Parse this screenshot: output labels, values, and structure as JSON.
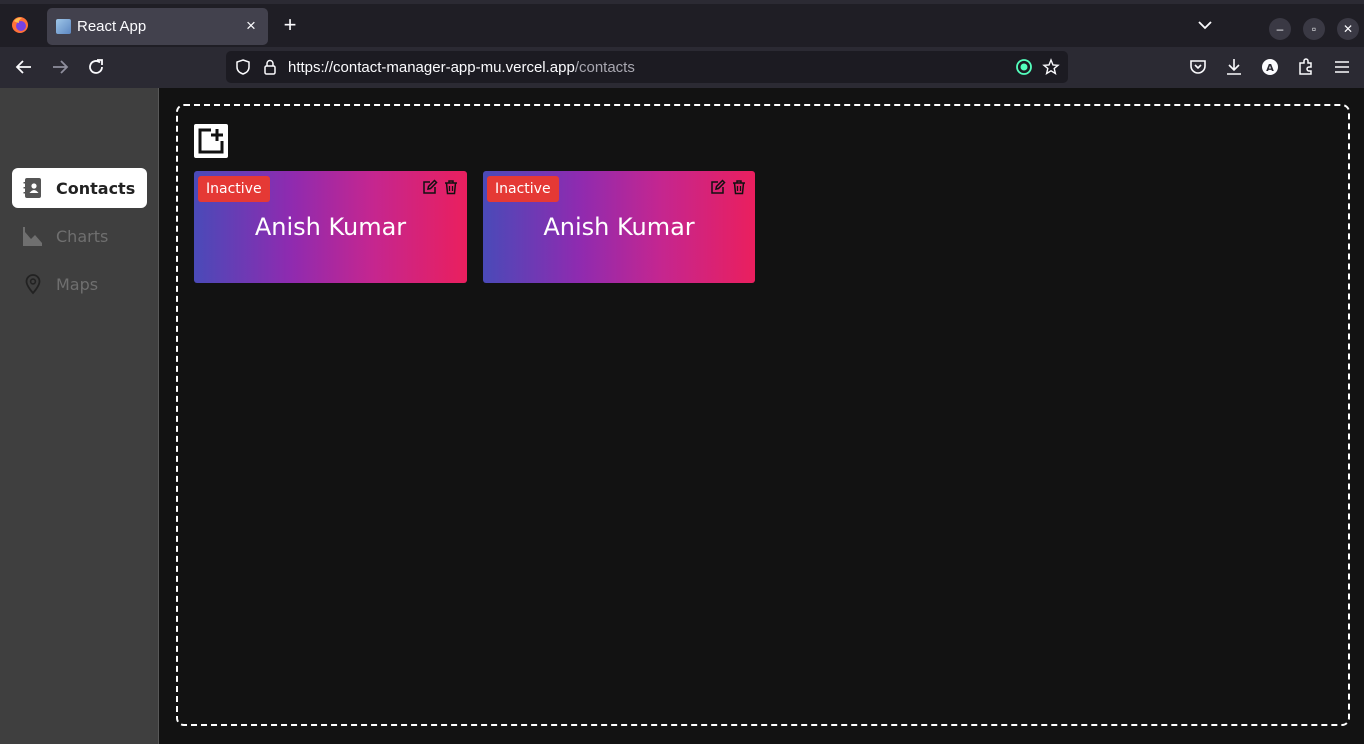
{
  "browser": {
    "tab_title": "React App",
    "url_main": "https://contact-manager-app-mu.vercel.app",
    "url_path": "/contacts"
  },
  "sidebar": {
    "items": [
      {
        "label": "Contacts",
        "icon": "contacts-book-icon",
        "active": true
      },
      {
        "label": "Charts",
        "icon": "chart-icon",
        "active": false
      },
      {
        "label": "Maps",
        "icon": "map-pin-icon",
        "active": false
      }
    ]
  },
  "contacts": {
    "add_icon": "add-contact-icon",
    "cards": [
      {
        "status": "Inactive",
        "name": "Anish Kumar"
      },
      {
        "status": "Inactive",
        "name": "Anish Kumar"
      }
    ]
  },
  "colors": {
    "badge": "#e53935",
    "card_gradient_start": "#4a4ab8",
    "card_gradient_end": "#ea1f5e",
    "page_background": "#121212",
    "sidebar_background": "#3f3f3f"
  }
}
